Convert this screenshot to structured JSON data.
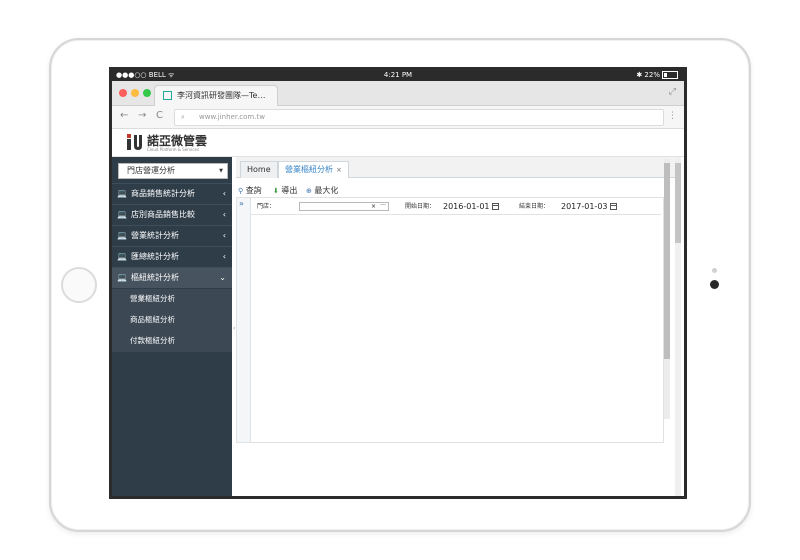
{
  "device": {
    "status_bar": {
      "carrier": "●●●○○ BELL ᯤ",
      "time": "4:21 PM",
      "battery": "✱ 22%"
    }
  },
  "browser": {
    "tab_title": "李河資訊研發團隊—Te…",
    "url": "www.jinher.com.tw",
    "colors": {
      "close": "#fc605c",
      "minimize": "#fdbc40",
      "zoom": "#34c84a"
    }
  },
  "app": {
    "logo": {
      "mark": "iU",
      "name": "諾亞微管雲",
      "subtitle": "Cloud Platform & Services"
    },
    "sidebar": {
      "select_value": "門店營運分析",
      "menu": [
        {
          "label": "商品銷售統計分析",
          "chevron": "‹"
        },
        {
          "label": "店別商品銷售比較",
          "chevron": "‹"
        },
        {
          "label": "營業統計分析",
          "chevron": "‹"
        },
        {
          "label": "匯總統計分析",
          "chevron": "‹"
        },
        {
          "label": "樞紐統計分析",
          "chevron": "⌄"
        }
      ],
      "submenu": [
        "營業樞紐分析",
        "商品樞紐分析",
        "付款樞紐分析"
      ]
    },
    "tabs": {
      "home": "Home",
      "active": "營業樞紐分析",
      "close": "×"
    },
    "toolbar": {
      "query": "查詢",
      "export": "導出",
      "maximize": "最大化"
    },
    "form": {
      "collapse": "»",
      "store_label": "門店：",
      "store_value": "",
      "clear": "×",
      "more": "···",
      "start_label": "開始日期：",
      "start_value": "2016-01-01",
      "end_label": "結束日期：",
      "end_value": "2017-01-03"
    }
  }
}
